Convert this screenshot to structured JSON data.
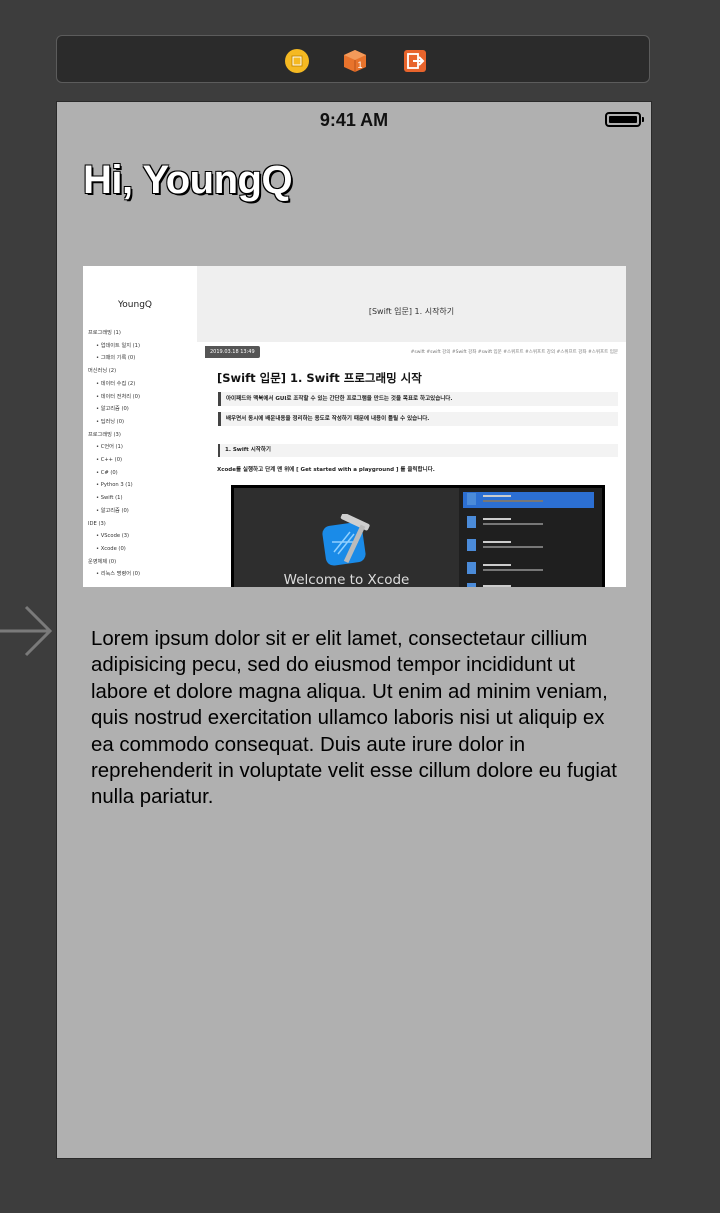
{
  "dock": {
    "items": [
      {
        "name": "view-controller-icon",
        "color": "#f5b922"
      },
      {
        "name": "first-responder-icon",
        "color": "#e8732c"
      },
      {
        "name": "exit-icon",
        "color": "#e8642c"
      }
    ]
  },
  "status_bar": {
    "time": "9:41 AM"
  },
  "greeting": "Hi, YoungQ",
  "blog": {
    "logo": "YoungQ",
    "categories": [
      {
        "label": "프로그래밍 (1)",
        "sub": false
      },
      {
        "label": "업데이트 일지 (1)",
        "sub": true
      },
      {
        "label": "그때의 기록 (0)",
        "sub": true
      },
      {
        "label": "머신러닝 (2)",
        "sub": false
      },
      {
        "label": "데이터 수집 (2)",
        "sub": true
      },
      {
        "label": "데이터 전처리 (0)",
        "sub": true
      },
      {
        "label": "알고리즘 (0)",
        "sub": true
      },
      {
        "label": "딥러닝 (0)",
        "sub": true
      },
      {
        "label": "프로그래밍 (3)",
        "sub": false
      },
      {
        "label": "C언어 (1)",
        "sub": true
      },
      {
        "label": "C++ (0)",
        "sub": true
      },
      {
        "label": "C# (0)",
        "sub": true
      },
      {
        "label": "Python 3 (1)",
        "sub": true
      },
      {
        "label": "Swift (1)",
        "sub": true
      },
      {
        "label": "알고리즘 (0)",
        "sub": true
      },
      {
        "label": "IDE (3)",
        "sub": false
      },
      {
        "label": "VScode (3)",
        "sub": true
      },
      {
        "label": "Xcode (0)",
        "sub": true
      },
      {
        "label": "운영체제 (0)",
        "sub": false
      },
      {
        "label": "리눅스 명령어 (0)",
        "sub": true
      }
    ],
    "header_title": "[Swift 입문] 1. 시작하기",
    "post_date": "2019.03.18 13:49",
    "post_tags": "#swift  #swift 강의  #Swift 강좌  #swift 입문  #스위프트  #스위프트 강의  #스위프트 강좌  #스위프트 입문",
    "post_title": "[Swift 입문] 1. Swift 프로그래밍 시작",
    "quote1": "아이패드와 맥북에서 GUI로 조작할 수 있는 간단한 프로그램을 만드는 것을 목표로 하고있습니다.",
    "quote2": "배우면서 동시에 배운내용을 정리하는 용도로 작성하기 때문에 내용이 틀릴 수 있습니다.",
    "section_head": "1. Swift 시작하기",
    "post_line": "Xcode를 실행하고 단계 맨 위에 [ Get started with a playground ] 를 클릭합니다.",
    "xcode_welcome": "Welcome to Xcode"
  },
  "body_text": "Lorem ipsum dolor sit er elit lamet, consectetaur cillium adipisicing pecu, sed do eiusmod tempor incididunt ut labore et dolore magna aliqua. Ut enim ad minim veniam, quis nostrud exercitation ullamco laboris nisi ut aliquip ex ea commodo consequat. Duis aute irure dolor in reprehenderit in voluptate velit esse cillum dolore eu fugiat nulla pariatur."
}
